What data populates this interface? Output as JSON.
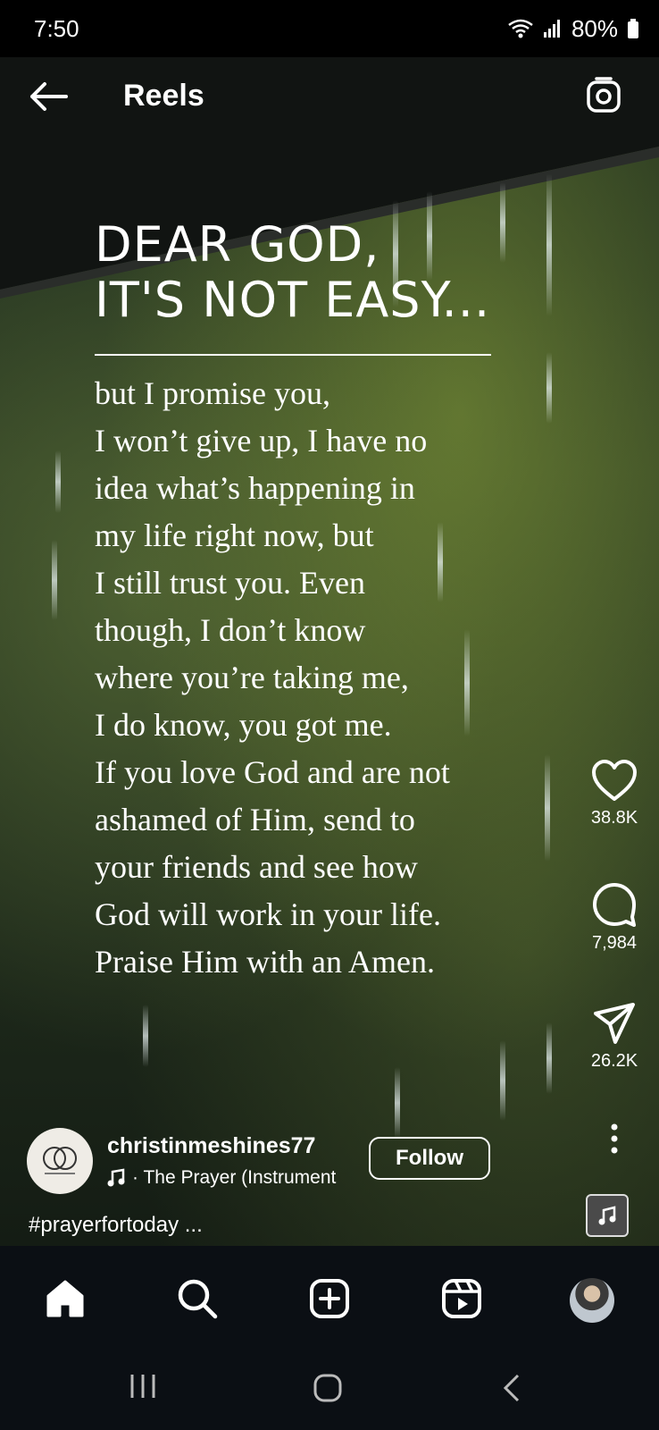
{
  "status_bar": {
    "time": "7:50",
    "battery": "80%"
  },
  "header": {
    "title": "Reels"
  },
  "reel": {
    "heading_lines": [
      "DEAR GOD,",
      "IT'S NOT EASY..."
    ],
    "body_lines": [
      "but I promise you,",
      "I won’t give up, I have no",
      "idea what’s happening in",
      "my life right now, but",
      "I still trust you. Even",
      "though, I don’t know",
      "where you’re taking me,",
      "I do know, you got me.",
      "If you love God and are not",
      "ashamed of Him, send to",
      "your friends and see how",
      "God will work in your life.",
      "Praise Him with an Amen."
    ]
  },
  "actions": {
    "likes": "38.8K",
    "comments": "7,984",
    "shares": "26.2K"
  },
  "author": {
    "username": "christinmeshines77",
    "audio_label": "· The Prayer (Instrument",
    "follow_label": "Follow",
    "caption": "#prayerfortoday ..."
  },
  "icons": [
    "back-arrow-icon",
    "camera-icon",
    "heart-icon",
    "comment-icon",
    "send-icon",
    "more-icon",
    "music-note-icon",
    "home-icon",
    "search-icon",
    "create-icon",
    "reels-icon"
  ]
}
